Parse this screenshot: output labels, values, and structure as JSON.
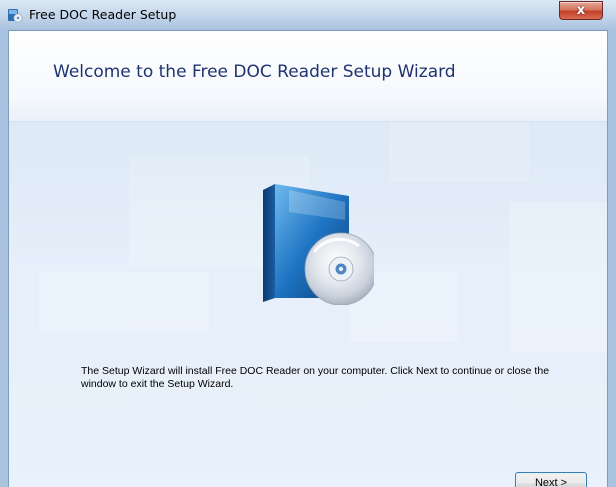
{
  "window": {
    "title": "Free DOC Reader Setup",
    "close_glyph": "x",
    "app_icon": "setup-installer-icon"
  },
  "banner": {
    "heading": "Welcome to the Free DOC Reader Setup Wizard"
  },
  "main": {
    "product_image": "software-box-with-cd",
    "description": "The Setup Wizard will install Free DOC Reader on your computer. Click Next to continue or close the window to exit the Setup Wizard."
  },
  "buttons": {
    "next_label": "Next >"
  },
  "colors": {
    "frame": "#aac3df",
    "heading_text": "#1f3370",
    "close_button": "#c4402a",
    "body_background": "#e6effa"
  }
}
